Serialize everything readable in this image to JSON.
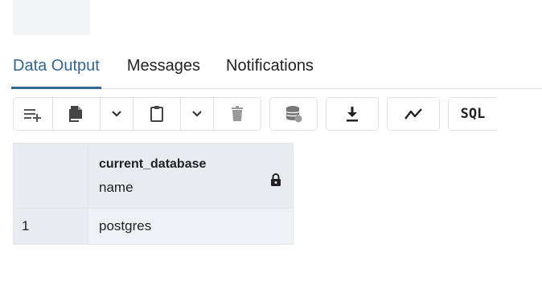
{
  "tabs": [
    {
      "label": "Data Output",
      "active": true
    },
    {
      "label": "Messages",
      "active": false
    },
    {
      "label": "Notifications",
      "active": false
    }
  ],
  "toolbar": {
    "buttons": [
      {
        "icon": "add-row-icon",
        "group": 1
      },
      {
        "icon": "copy-icon",
        "group": 1
      },
      {
        "icon": "chevron-down-icon",
        "group": 1
      },
      {
        "icon": "paste-icon",
        "group": 1
      },
      {
        "icon": "chevron-down-icon",
        "group": 1
      },
      {
        "icon": "delete-icon",
        "group": 1
      },
      {
        "icon": "save-data-icon",
        "group": 2
      },
      {
        "icon": "download-icon",
        "group": 3
      },
      {
        "icon": "graph-icon",
        "group": 4
      },
      {
        "icon": "sql-icon",
        "group": 5
      }
    ],
    "sql_label": "SQL"
  },
  "grid": {
    "columns": [
      {
        "name": "current_database",
        "type": "name",
        "readonly": true
      }
    ],
    "rows": [
      {
        "row_number": "1",
        "values": [
          "postgres"
        ]
      }
    ]
  },
  "colors": {
    "accent": "#326690",
    "header_bg": "#e8ebf0",
    "border": "#dde0e6"
  }
}
